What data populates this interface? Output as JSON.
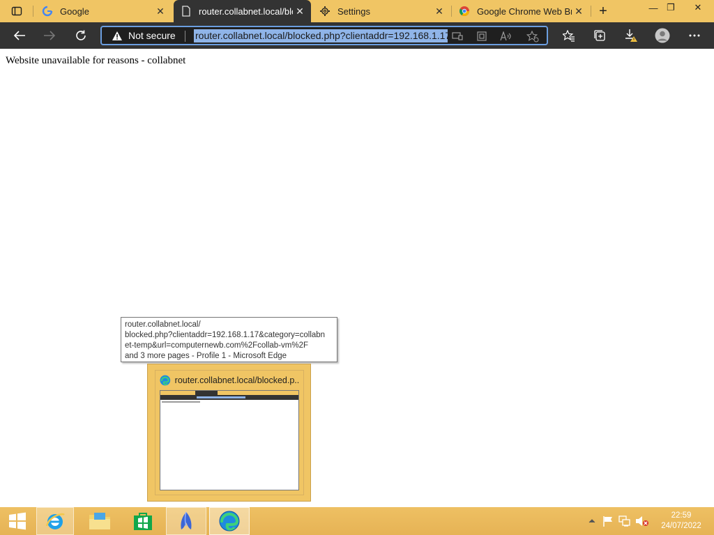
{
  "browser": {
    "tabs": [
      {
        "title": "Google",
        "icon": "google-icon",
        "active": false
      },
      {
        "title": "router.collabnet.local/blo",
        "icon": "page-icon",
        "active": true
      },
      {
        "title": "Settings",
        "icon": "gear-icon",
        "active": false
      },
      {
        "title": "Google Chrome Web Bro",
        "icon": "chrome-icon",
        "active": false
      }
    ],
    "new_tab": "+",
    "window_controls": {
      "minimize": "—",
      "restore": "❐",
      "close": "✕"
    },
    "address": {
      "security_label": "Not secure",
      "url": "router.collabnet.local/blocked.php?clientaddr=192.168.1.17"
    }
  },
  "page": {
    "message": "Website unavailable for reasons - collabnet"
  },
  "tooltip": {
    "lines": [
      "router.collabnet.local/",
      "blocked.php?clientaddr=192.168.1.17&category=collabn",
      "et-temp&url=computernewb.com%2Fcollab-vm%2F",
      "and 3 more pages - Profile 1 - Microsoft Edge"
    ]
  },
  "thumbnail": {
    "title": "router.collabnet.local/blocked.p..."
  },
  "taskbar": {
    "apps": [
      "start",
      "internet-explorer",
      "file-explorer",
      "store",
      "bluebird-app",
      "edge"
    ],
    "clock": {
      "time": "22:59",
      "date": "24/07/2022"
    }
  },
  "colors": {
    "accent": "#f0c564",
    "toolbar": "#333333",
    "url_highlight": "#8fb4e8"
  }
}
